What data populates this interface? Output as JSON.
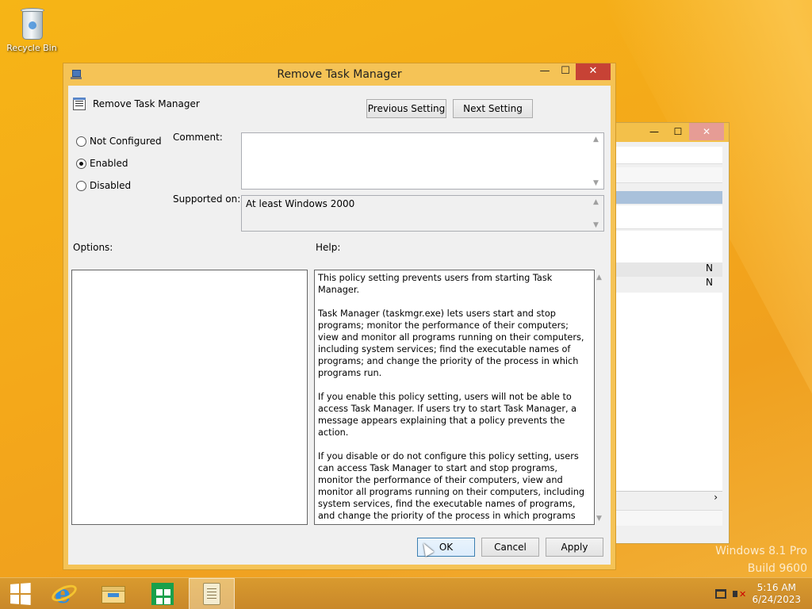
{
  "desktop": {
    "recycle_bin_label": "Recycle Bin"
  },
  "background_window": {
    "min_glyph": "—",
    "max_glyph": "☐",
    "close_glyph": "✕",
    "row_values": [
      "N",
      "N"
    ],
    "scroll_right": "›"
  },
  "dialog": {
    "title": "Remove Task Manager",
    "policy_name": "Remove Task Manager",
    "previous_setting": "Previous Setting",
    "next_setting": "Next Setting",
    "radios": {
      "not_configured": "Not Configured",
      "enabled": "Enabled",
      "disabled": "Disabled",
      "selected": "enabled"
    },
    "comment_label": "Comment:",
    "comment_value": "",
    "supported_label": "Supported on:",
    "supported_value": "At least Windows 2000",
    "options_label": "Options:",
    "help_label": "Help:",
    "help_paragraphs": [
      "This policy setting prevents users from starting Task Manager.",
      "Task Manager (taskmgr.exe) lets users start and stop programs; monitor the performance of their computers; view and monitor all programs running on their computers, including system services; find the executable names of programs; and change the priority of the process in which programs run.",
      "If you enable this policy setting, users will not be able to access Task Manager. If users try to start Task Manager, a message appears explaining that a policy prevents the action.",
      "If you disable or do not configure this policy setting, users can access Task Manager to  start and stop programs, monitor the performance of their computers, view and monitor all programs running on their computers, including system services, find the executable names of programs, and change the priority of the process in which programs run."
    ],
    "ok": "OK",
    "cancel": "Cancel",
    "apply": "Apply",
    "window_controls": {
      "minimize": "—",
      "maximize": "☐",
      "close": "✕"
    }
  },
  "watermark": {
    "line1": "Windows 8.1 Pro",
    "line2": "Build 9600"
  },
  "taskbar": {
    "items": [
      "start-icon",
      "internet-explorer-icon",
      "file-explorer-icon",
      "store-icon",
      "group-policy-editor-icon"
    ],
    "clock": {
      "time": "5:16 AM",
      "date": "6/24/2023"
    },
    "volume_muted_glyph": "✕"
  },
  "colors": {
    "title_bar": "#f5c356",
    "close_button": "#c74235",
    "taskbar": "#d99a2e",
    "wallpaper": "#f4a81a"
  }
}
